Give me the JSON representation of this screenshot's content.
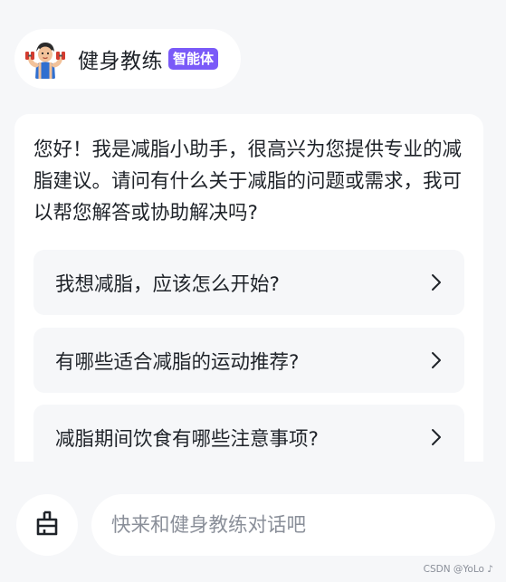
{
  "agent": {
    "name": "健身教练",
    "badge": "智能体",
    "avatar_icon": "fitness-coach-avatar"
  },
  "message": {
    "greeting": "您好！我是减脂小助手，很高兴为您提供专业的减脂建议。请问有什么关于减脂的问题或需求，我可以帮您解答或协助解决吗?",
    "suggestions": [
      {
        "label": "我想减脂，应该怎么开始?"
      },
      {
        "label": "有哪些适合减脂的运动推荐?"
      },
      {
        "label": "减脂期间饮食有哪些注意事项?"
      }
    ]
  },
  "input": {
    "placeholder": "快来和健身教练对话吧",
    "clear_icon": "broom-icon"
  },
  "watermark": "CSDN @YoLo ♪",
  "colors": {
    "background": "#f6f7f9",
    "badge": "#7a5af8",
    "text": "#1f2329",
    "placeholder": "#8a8f99"
  }
}
